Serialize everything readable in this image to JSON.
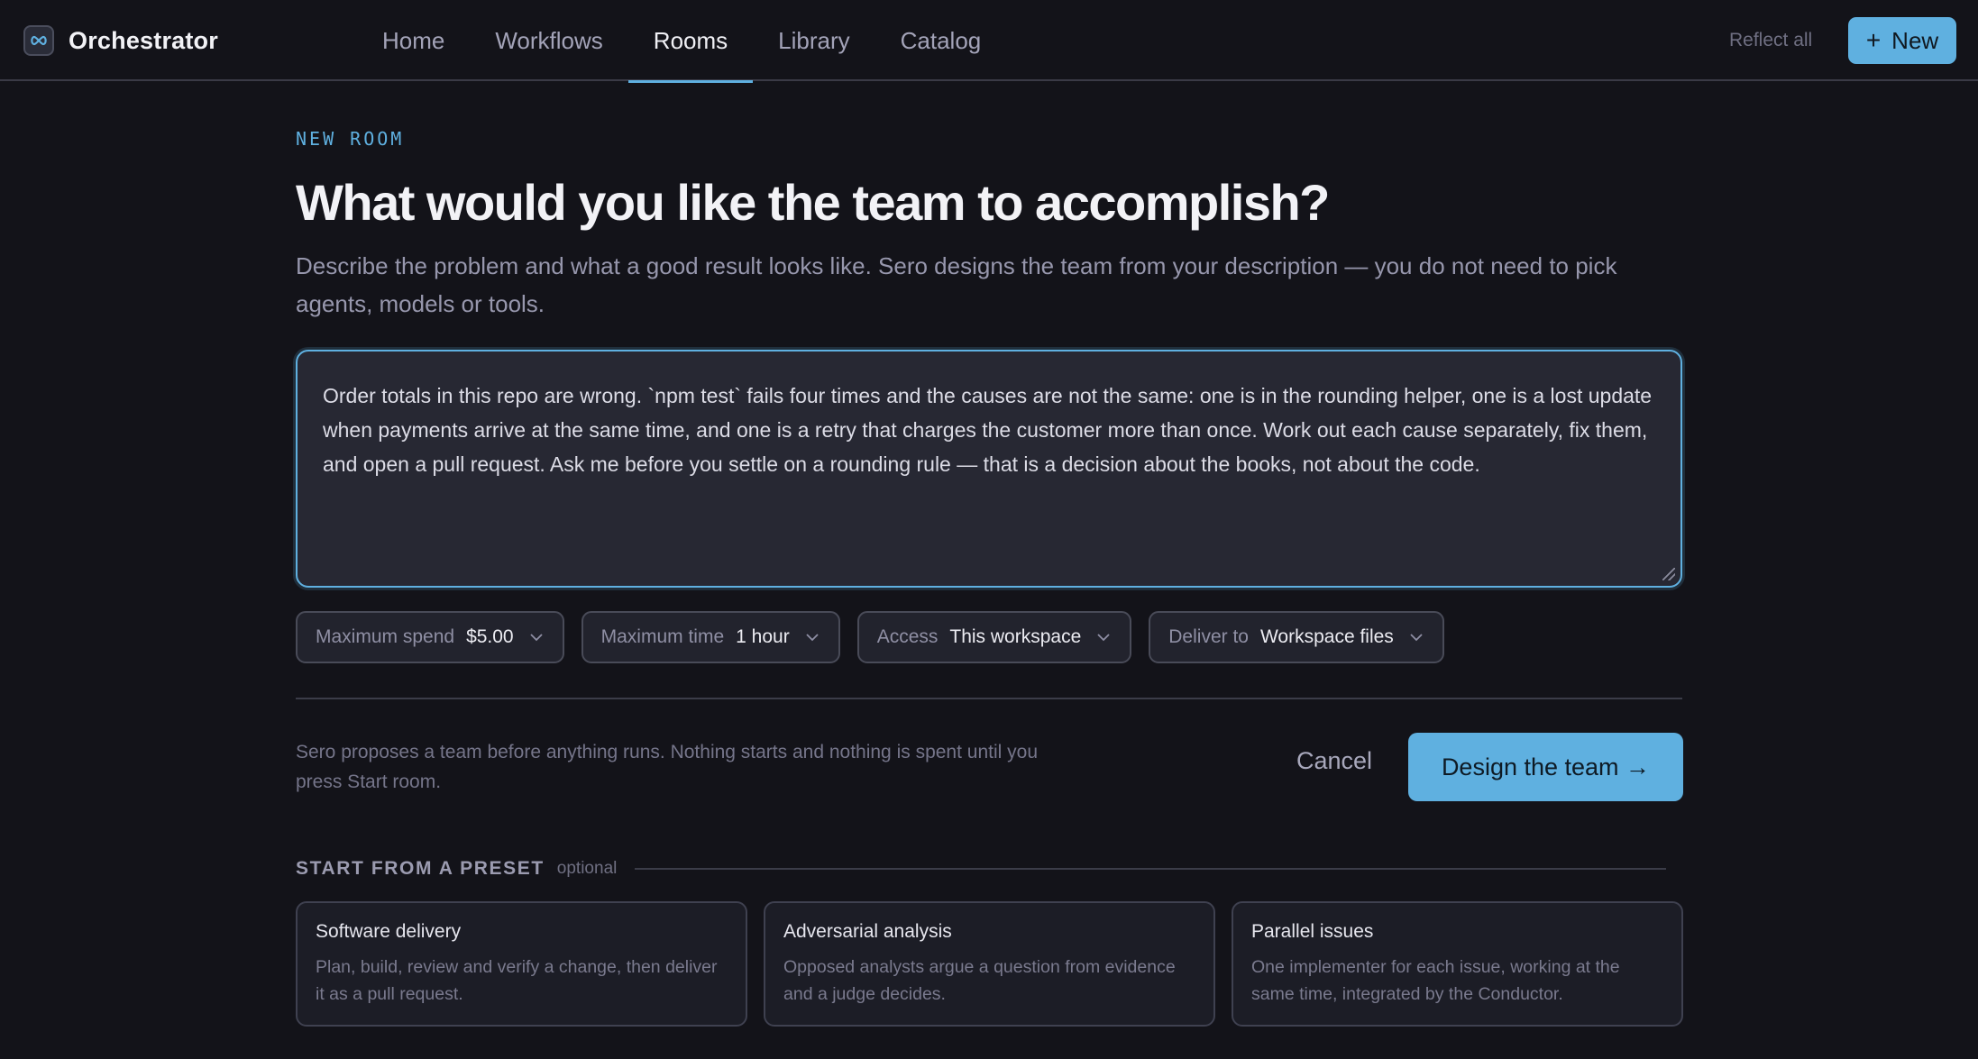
{
  "header": {
    "app_name": "Orchestrator",
    "logo_icon": "infinity-icon",
    "nav": [
      {
        "label": "Home",
        "active": false
      },
      {
        "label": "Workflows",
        "active": false
      },
      {
        "label": "Rooms",
        "active": true
      },
      {
        "label": "Library",
        "active": false
      },
      {
        "label": "Catalog",
        "active": false
      }
    ],
    "reflect_label": "Reflect all",
    "new_label": "New",
    "new_icon": "plus-icon",
    "accent_color": "#5fb0e0"
  },
  "main": {
    "eyebrow": "NEW ROOM",
    "title": "What would you like the team to accomplish?",
    "subtitle": "Describe the problem and what a good result looks like. Sero designs the team from your description — you do not need to pick agents, models or tools.",
    "goal_text": "Order totals in this repo are wrong. `npm test` fails four times and the causes are not the same: one is in the rounding helper, one is a lost update when payments arrive at the same time, and one is a retry that charges the customer more than once. Work out each cause separately, fix them, and open a pull request. Ask me before you settle on a rounding rule — that is a decision about the books, not about the code.",
    "controls": [
      {
        "label": "Maximum spend",
        "value": "$5.00"
      },
      {
        "label": "Maximum time",
        "value": "1 hour"
      },
      {
        "label": "Access",
        "value": "This workspace"
      },
      {
        "label": "Deliver to",
        "value": "Workspace files"
      }
    ],
    "note": "Sero proposes a team before anything runs. Nothing starts and nothing is spent until you press Start room.",
    "cancel_label": "Cancel",
    "design_label": "Design the team →"
  },
  "presets": {
    "title": "START FROM A PRESET",
    "optional_label": "optional",
    "items": [
      {
        "title": "Software delivery",
        "description": "Plan, build, review and verify a change, then deliver it as a pull request."
      },
      {
        "title": "Adversarial analysis",
        "description": "Opposed analysts argue a question from evidence and a judge decides."
      },
      {
        "title": "Parallel issues",
        "description": "One implementer for each issue, working at the same time, integrated by the Conductor."
      }
    ]
  }
}
